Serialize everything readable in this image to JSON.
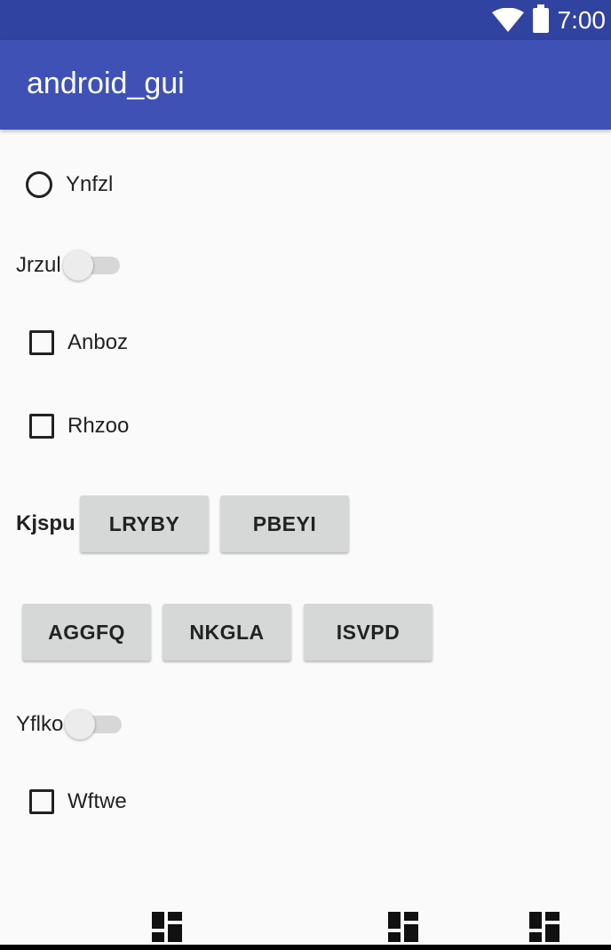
{
  "status_bar": {
    "time": "7:00"
  },
  "app_bar": {
    "title": "android_gui"
  },
  "controls": {
    "radio_ynfzl": {
      "label": "Ynfzl",
      "checked": false
    },
    "switch_jrzul": {
      "label": "Jrzul",
      "on": false
    },
    "checkbox_anboz": {
      "label": "Anboz",
      "checked": false
    },
    "checkbox_rhzoo": {
      "label": "Rhzoo",
      "checked": false
    },
    "kjspu_label": "Kjspu",
    "buttons_row1": [
      "LRYBY",
      "PBEYI"
    ],
    "buttons_row2": [
      "AGGFQ",
      "NKGLA",
      "ISVPD"
    ],
    "switch_yflko": {
      "label": "Yflko",
      "on": false
    },
    "checkbox_wftwe": {
      "label": "Wftwe",
      "checked": false
    }
  },
  "nav_icons": [
    "dashboard-icon",
    "dashboard-icon",
    "dashboard-icon"
  ]
}
